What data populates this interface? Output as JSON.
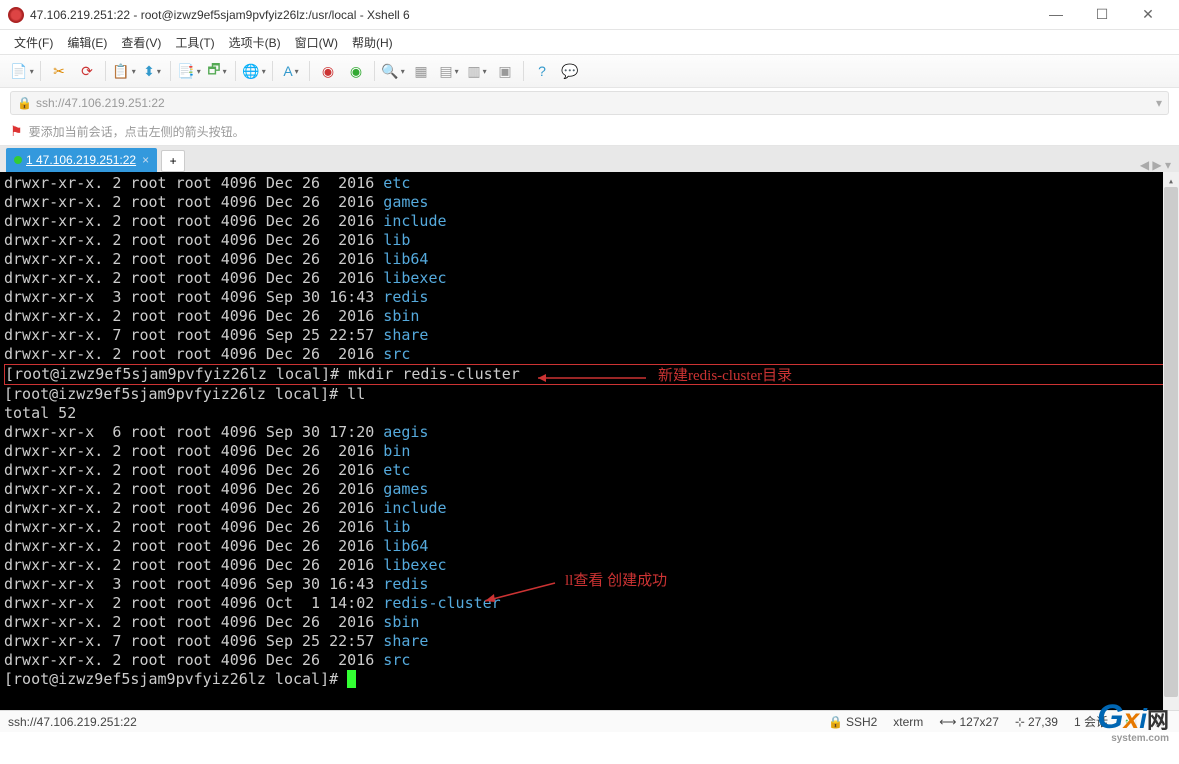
{
  "window": {
    "title": "47.106.219.251:22 - root@izwz9ef5sjam9pvfyiz26lz:/usr/local - Xshell 6"
  },
  "menu": {
    "file": "文件(F)",
    "edit": "编辑(E)",
    "view": "查看(V)",
    "tools": "工具(T)",
    "tabs": "选项卡(B)",
    "window": "窗口(W)",
    "help": "帮助(H)"
  },
  "address": {
    "url": "ssh://47.106.219.251:22"
  },
  "tip": {
    "text": "要添加当前会话，点击左侧的箭头按钮。"
  },
  "tab": {
    "label": "1 47.106.219.251:22",
    "add": "+"
  },
  "terminal": {
    "lines": [
      {
        "perm": "drwxr-xr-x. 2 root root 4096 Dec 26  2016 ",
        "name": "etc"
      },
      {
        "perm": "drwxr-xr-x. 2 root root 4096 Dec 26  2016 ",
        "name": "games"
      },
      {
        "perm": "drwxr-xr-x. 2 root root 4096 Dec 26  2016 ",
        "name": "include"
      },
      {
        "perm": "drwxr-xr-x. 2 root root 4096 Dec 26  2016 ",
        "name": "lib"
      },
      {
        "perm": "drwxr-xr-x. 2 root root 4096 Dec 26  2016 ",
        "name": "lib64"
      },
      {
        "perm": "drwxr-xr-x. 2 root root 4096 Dec 26  2016 ",
        "name": "libexec"
      },
      {
        "perm": "drwxr-xr-x  3 root root 4096 Sep 30 16:43 ",
        "name": "redis"
      },
      {
        "perm": "drwxr-xr-x. 2 root root 4096 Dec 26  2016 ",
        "name": "sbin"
      },
      {
        "perm": "drwxr-xr-x. 7 root root 4096 Sep 25 22:57 ",
        "name": "share"
      },
      {
        "perm": "drwxr-xr-x. 2 root root 4096 Dec 26  2016 ",
        "name": "src"
      }
    ],
    "cmd1_prompt": "[root@izwz9ef5sjam9pvfyiz26lz local]# ",
    "cmd1": "mkdir redis-cluster",
    "cmd2_prompt": "[root@izwz9ef5sjam9pvfyiz26lz local]# ",
    "cmd2": "ll",
    "total": "total 52",
    "lines2": [
      {
        "perm": "drwxr-xr-x  6 root root 4096 Sep 30 17:20 ",
        "name": "aegis"
      },
      {
        "perm": "drwxr-xr-x. 2 root root 4096 Dec 26  2016 ",
        "name": "bin"
      },
      {
        "perm": "drwxr-xr-x. 2 root root 4096 Dec 26  2016 ",
        "name": "etc"
      },
      {
        "perm": "drwxr-xr-x. 2 root root 4096 Dec 26  2016 ",
        "name": "games"
      },
      {
        "perm": "drwxr-xr-x. 2 root root 4096 Dec 26  2016 ",
        "name": "include"
      },
      {
        "perm": "drwxr-xr-x. 2 root root 4096 Dec 26  2016 ",
        "name": "lib"
      },
      {
        "perm": "drwxr-xr-x. 2 root root 4096 Dec 26  2016 ",
        "name": "lib64"
      },
      {
        "perm": "drwxr-xr-x. 2 root root 4096 Dec 26  2016 ",
        "name": "libexec"
      },
      {
        "perm": "drwxr-xr-x  3 root root 4096 Sep 30 16:43 ",
        "name": "redis"
      },
      {
        "perm": "drwxr-xr-x  2 root root 4096 Oct  1 14:02 ",
        "name": "redis-cluster"
      },
      {
        "perm": "drwxr-xr-x. 2 root root 4096 Dec 26  2016 ",
        "name": "sbin"
      },
      {
        "perm": "drwxr-xr-x. 7 root root 4096 Sep 25 22:57 ",
        "name": "share"
      },
      {
        "perm": "drwxr-xr-x. 2 root root 4096 Dec 26  2016 ",
        "name": "src"
      }
    ],
    "cmd3_prompt": "[root@izwz9ef5sjam9pvfyiz26lz local]# ",
    "cursor": " "
  },
  "annotations": {
    "a1": "新建redis-cluster目录",
    "a2": "ll查看  创建成功"
  },
  "status": {
    "left": "ssh://47.106.219.251:22",
    "ssh": "SSH2",
    "term": "xterm",
    "size": "127x27",
    "pos": "27,39",
    "sessions": "1 会话",
    "net": "↑"
  },
  "watermark": {
    "text": "Gxi网",
    "sub": "system.com"
  }
}
